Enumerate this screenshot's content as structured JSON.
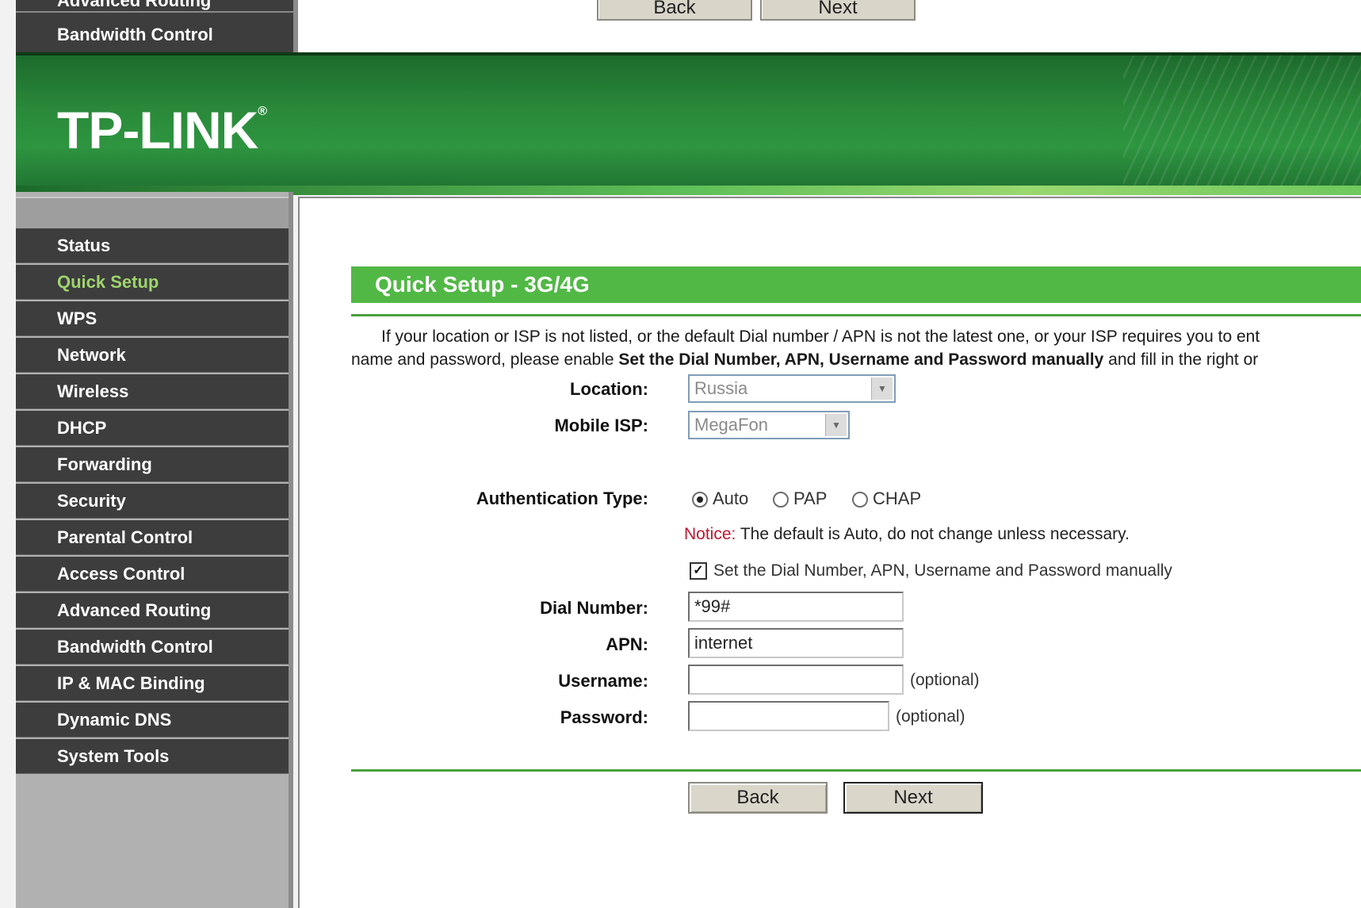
{
  "top_fragment": {
    "cut_sidebar_item": "Advanced Routing",
    "sidebar_item": "Bandwidth Control",
    "back_label": "Back",
    "next_label": "Next"
  },
  "header": {
    "logo_text": "TP-LINK",
    "logo_mark": "®",
    "brand_color": "#2a8a3a"
  },
  "sidebar": {
    "items": [
      {
        "label": "Status"
      },
      {
        "label": "Quick Setup",
        "active": true
      },
      {
        "label": "WPS"
      },
      {
        "label": "Network"
      },
      {
        "label": "Wireless"
      },
      {
        "label": "DHCP"
      },
      {
        "label": "Forwarding"
      },
      {
        "label": "Security"
      },
      {
        "label": "Parental Control"
      },
      {
        "label": "Access Control"
      },
      {
        "label": "Advanced Routing"
      },
      {
        "label": "Bandwidth Control"
      },
      {
        "label": "IP & MAC Binding"
      },
      {
        "label": "Dynamic DNS"
      },
      {
        "label": "System Tools"
      }
    ],
    "active_color": "#9ed46e"
  },
  "main": {
    "title": "Quick Setup - 3G/4G",
    "intro": {
      "line1": "If your location or ISP is not listed, or the default Dial number / APN is not the latest one, or your ISP requires you to ent",
      "line2_prefix": "name and password, please enable ",
      "line2_bold": "Set the Dial Number, APN, Username and Password manually",
      "line2_suffix": " and fill in the right or"
    },
    "location": {
      "label": "Location:",
      "value": "Russia"
    },
    "mobile_isp": {
      "label": "Mobile ISP:",
      "value": "MegaFon"
    },
    "auth": {
      "label": "Authentication Type:",
      "options": [
        "Auto",
        "PAP",
        "CHAP"
      ],
      "selected": "Auto"
    },
    "notice": {
      "label": "Notice:",
      "text": " The default is Auto, do not change unless necessary."
    },
    "manual_checkbox": {
      "label": "Set the Dial Number, APN, Username and Password manually",
      "checked": true,
      "mark": "✓"
    },
    "dial_number": {
      "label": "Dial Number:",
      "value": "*99#"
    },
    "apn": {
      "label": "APN:",
      "value": "internet"
    },
    "username": {
      "label": "Username:",
      "value": "",
      "hint": "(optional)"
    },
    "password": {
      "label": "Password:",
      "value": "",
      "hint": "(optional)"
    },
    "back_label": "Back",
    "next_label": "Next",
    "title_color": "#51b845",
    "notice_color": "#c2152e"
  }
}
